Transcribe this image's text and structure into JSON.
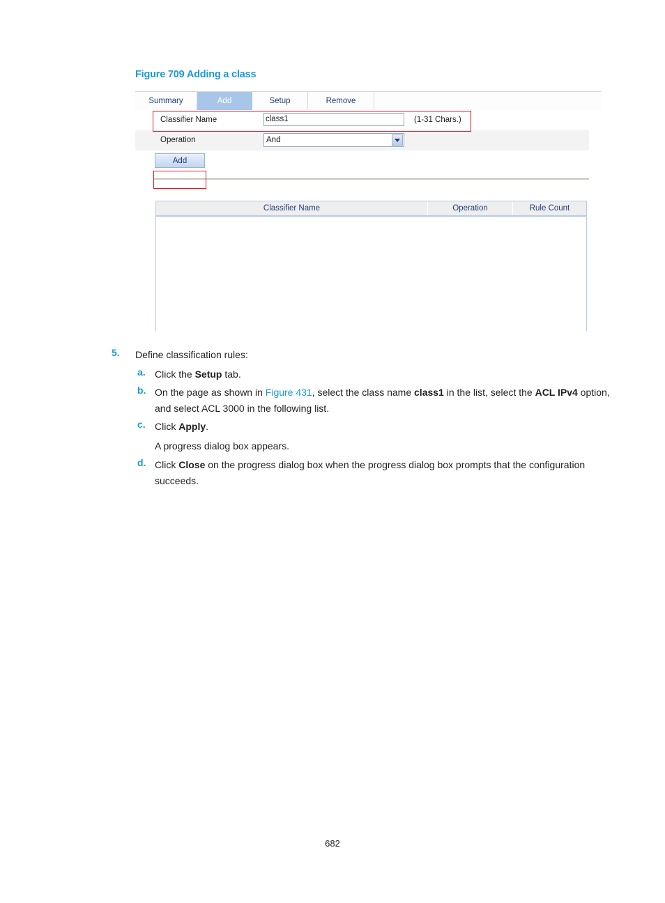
{
  "figure": {
    "caption": "Figure 709 Adding a class"
  },
  "screenshot": {
    "tabs": [
      {
        "label": "Summary",
        "active": false
      },
      {
        "label": "Add",
        "active": true
      },
      {
        "label": "Setup",
        "active": false
      },
      {
        "label": "Remove",
        "active": false
      }
    ],
    "form": {
      "classifier_name_label": "Classifier Name",
      "classifier_name_value": "class1",
      "classifier_name_hint": "(1-31 Chars.)",
      "operation_label": "Operation",
      "operation_value": "And",
      "add_button_label": "Add"
    },
    "table": {
      "columns": [
        "Classifier Name",
        "Operation",
        "Rule Count"
      ],
      "rows": []
    },
    "colors": {
      "active_tab_bg": "#a8c6e8",
      "header_text": "#1f3d7a",
      "annotation": "#e8142a"
    }
  },
  "steps": {
    "step5": {
      "marker": "5.",
      "text": "Define classification rules:"
    },
    "a": {
      "marker": "a.",
      "pre": "Click the ",
      "bold": "Setup",
      "post": " tab."
    },
    "b": {
      "marker": "b.",
      "p1": "On the page as shown in ",
      "link": "Figure 431",
      "p2": ", select the class name ",
      "bold1": "class1",
      "p3": " in the list, select the ",
      "bold2": "ACL IPv4",
      "p4": " option, and select ACL 3000 in the following list."
    },
    "c": {
      "marker": "c.",
      "pre": "Click ",
      "bold": "Apply",
      "post": ".",
      "note": "A progress dialog box appears."
    },
    "d": {
      "marker": "d.",
      "pre": "Click ",
      "bold": "Close",
      "post": " on the progress dialog box when the progress dialog box prompts that the configuration succeeds."
    }
  },
  "footer": {
    "page_number": "682"
  }
}
